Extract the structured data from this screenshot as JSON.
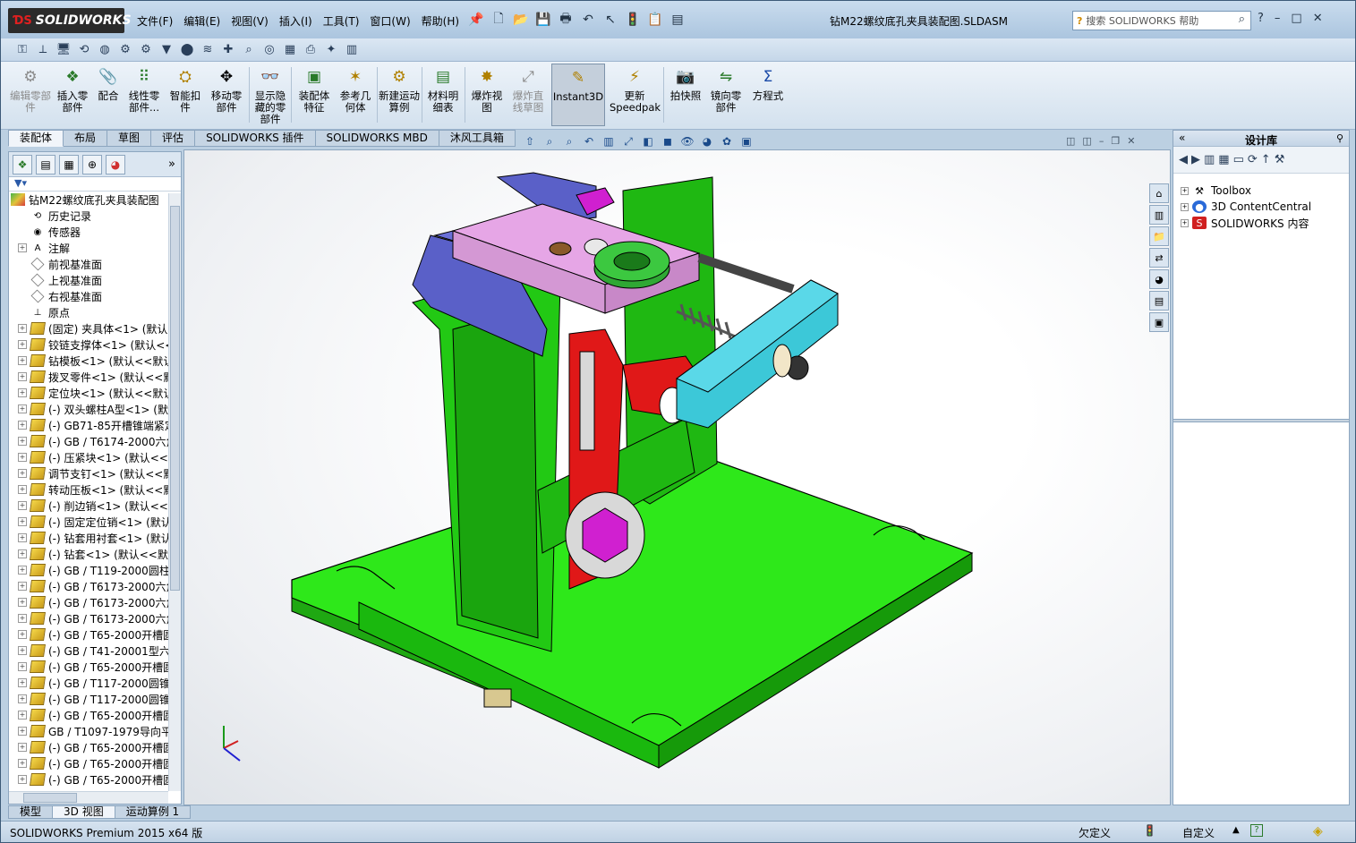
{
  "app": {
    "logo": "SOLIDWORKS",
    "doc_title": "钻M22螺纹底孔夹具装配图.SLDASM",
    "help_search_placeholder": "搜索 SOLIDWORKS 帮助"
  },
  "menu": [
    "文件(F)",
    "编辑(E)",
    "视图(V)",
    "插入(I)",
    "工具(T)",
    "窗口(W)",
    "帮助(H)"
  ],
  "commands": [
    {
      "label": "编辑零部件",
      "icon": "edit-component-icon",
      "disabled": true
    },
    {
      "label": "插入零部件",
      "icon": "insert-component-icon",
      "disabled": false
    },
    {
      "label": "配合",
      "icon": "mate-icon",
      "disabled": false
    },
    {
      "label": "线性零部件...",
      "icon": "linear-pattern-icon",
      "disabled": false
    },
    {
      "label": "智能扣件",
      "icon": "smart-fastener-icon",
      "disabled": false
    },
    {
      "label": "移动零部件",
      "icon": "move-component-icon",
      "disabled": false
    },
    {
      "label": "显示隐藏的零部件",
      "icon": "show-hidden-icon",
      "disabled": false
    },
    {
      "label": "装配体特征",
      "icon": "assembly-feature-icon",
      "disabled": false
    },
    {
      "label": "参考几何体",
      "icon": "reference-geometry-icon",
      "disabled": false
    },
    {
      "label": "新建运动算例",
      "icon": "motion-study-icon",
      "disabled": false
    },
    {
      "label": "材料明细表",
      "icon": "bom-icon",
      "disabled": false
    },
    {
      "label": "爆炸视图",
      "icon": "exploded-view-icon",
      "disabled": false
    },
    {
      "label": "爆炸直线草图",
      "icon": "explode-line-icon",
      "disabled": true
    },
    {
      "label": "Instant3D",
      "icon": "instant3d-icon",
      "disabled": false,
      "active": true
    },
    {
      "label": "更新Speedpak",
      "icon": "speedpak-icon",
      "disabled": false
    },
    {
      "label": "拍快照",
      "icon": "snapshot-icon",
      "disabled": false
    },
    {
      "label": "镜向零部件",
      "icon": "mirror-component-icon",
      "disabled": false
    },
    {
      "label": "方程式",
      "icon": "equation-icon",
      "disabled": false
    }
  ],
  "cmd_tabs": [
    "装配体",
    "布局",
    "草图",
    "评估",
    "SOLIDWORKS 插件",
    "SOLIDWORKS MBD",
    "沐风工具箱"
  ],
  "tree": {
    "root": "钻M22螺纹底孔夹具装配图",
    "items": [
      {
        "label": "历史记录",
        "type": "history",
        "exp": false
      },
      {
        "label": "传感器",
        "type": "sensor",
        "exp": false
      },
      {
        "label": "注解",
        "type": "annotation",
        "exp": true
      },
      {
        "label": "前视基准面",
        "type": "plane",
        "exp": false
      },
      {
        "label": "上视基准面",
        "type": "plane",
        "exp": false
      },
      {
        "label": "右视基准面",
        "type": "plane",
        "exp": false
      },
      {
        "label": "原点",
        "type": "origin",
        "exp": false
      },
      {
        "label": "(固定) 夹具体<1> (默认<",
        "type": "part",
        "exp": true
      },
      {
        "label": "铰链支撑体<1> (默认<<",
        "type": "part",
        "exp": true
      },
      {
        "label": "钻模板<1> (默认<<默认",
        "type": "part",
        "exp": true
      },
      {
        "label": "拨叉零件<1> (默认<<默",
        "type": "part",
        "exp": true
      },
      {
        "label": "定位块<1> (默认<<默认",
        "type": "part",
        "exp": true
      },
      {
        "label": "(-) 双头螺柱A型<1> (默认",
        "type": "part",
        "exp": true
      },
      {
        "label": "(-) GB71-85开槽锥端紧定",
        "type": "part",
        "exp": true
      },
      {
        "label": "(-) GB / T6174-2000六角",
        "type": "part",
        "exp": true
      },
      {
        "label": "(-) 压紧块<1> (默认<<默",
        "type": "part",
        "exp": true
      },
      {
        "label": "调节支钉<1> (默认<<默",
        "type": "part",
        "exp": true
      },
      {
        "label": "转动压板<1> (默认<<默",
        "type": "part",
        "exp": true
      },
      {
        "label": "(-) 削边销<1> (默认<<默",
        "type": "part",
        "exp": true
      },
      {
        "label": "(-) 固定定位销<1> (默认",
        "type": "part",
        "exp": true
      },
      {
        "label": "(-) 钻套用衬套<1> (默认",
        "type": "part",
        "exp": true
      },
      {
        "label": "(-) 钻套<1> (默认<<默认",
        "type": "part",
        "exp": true
      },
      {
        "label": "(-) GB / T119-2000圆柱销",
        "type": "part",
        "exp": true
      },
      {
        "label": "(-) GB / T6173-2000六角",
        "type": "part",
        "exp": true
      },
      {
        "label": "(-) GB / T6173-2000六角",
        "type": "part",
        "exp": true
      },
      {
        "label": "(-) GB / T6173-2000六角",
        "type": "part",
        "exp": true
      },
      {
        "label": "(-) GB / T65-2000开槽圆",
        "type": "part",
        "exp": true
      },
      {
        "label": "(-) GB / T41-20001型六角",
        "type": "part",
        "exp": true
      },
      {
        "label": "(-) GB / T65-2000开槽圆",
        "type": "part",
        "exp": true
      },
      {
        "label": "(-) GB / T117-2000圆锥销",
        "type": "part",
        "exp": true
      },
      {
        "label": "(-) GB / T117-2000圆锥销",
        "type": "part",
        "exp": true
      },
      {
        "label": "(-) GB / T65-2000开槽圆",
        "type": "part",
        "exp": true
      },
      {
        "label": "GB / T1097-1979导向平键",
        "type": "part",
        "exp": true
      },
      {
        "label": "(-) GB / T65-2000开槽圆",
        "type": "part",
        "exp": true
      },
      {
        "label": "(-) GB / T65-2000开槽圆",
        "type": "part",
        "exp": true
      },
      {
        "label": "(-) GB / T65-2000开槽圆",
        "type": "part",
        "exp": true
      }
    ]
  },
  "task_pane": {
    "title": "设计库",
    "items": [
      {
        "label": "Toolbox",
        "icon": "toolbox-icon"
      },
      {
        "label": "3D ContentCentral",
        "icon": "globe-icon"
      },
      {
        "label": "SOLIDWORKS 内容",
        "icon": "sw-content-icon"
      }
    ]
  },
  "bottom_tabs": [
    "模型",
    "3D 视图",
    "运动算例 1"
  ],
  "status": {
    "product": "SOLIDWORKS Premium 2015 x64 版",
    "state": "欠定义",
    "units": "自定义"
  },
  "colors": {
    "base": "#2ee81a",
    "pink_plate": "#e6a6e6",
    "blue_block": "#5a60c8",
    "red_part": "#e01818",
    "cyan_bar": "#3cc8d8",
    "bushing_green": "#3cb840",
    "magenta": "#d020d0"
  }
}
